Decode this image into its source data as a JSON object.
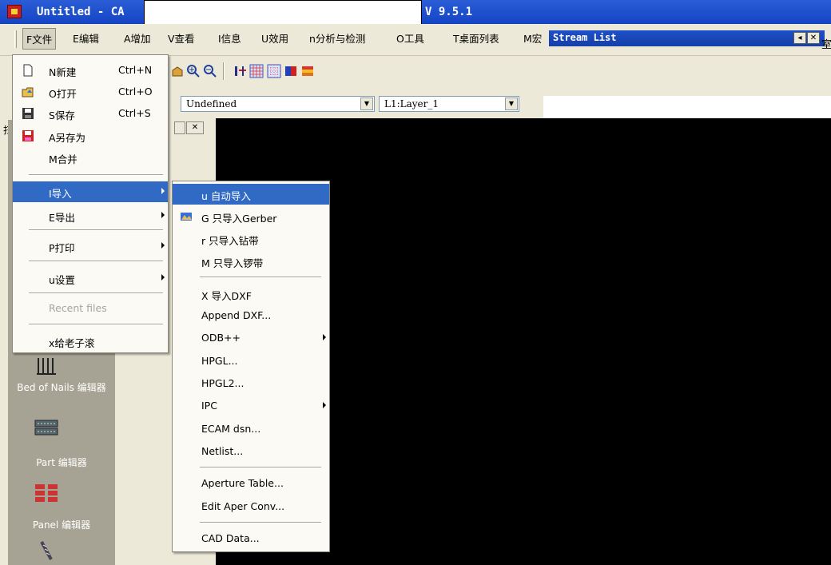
{
  "window": {
    "title": "Untitled - CA",
    "version": "V 9.5.1"
  },
  "menubar": {
    "items": [
      "F文件",
      "E编辑",
      "A增加",
      "V查看",
      "I信息",
      "U效用",
      "n分析与检测",
      "O工具",
      "T桌面列表",
      "M宏"
    ]
  },
  "stream_list": {
    "title": "Stream List",
    "right_text": "室"
  },
  "toolbar": {
    "combo1_value": "Undefined",
    "combo2_value": "L1:Layer_1"
  },
  "side_panel": {
    "tool_label_1": "Bed of Nails 编辑器",
    "tool_label_2": "Part 编辑器",
    "tool_label_3": "Panel 编辑器",
    "partial_glyph": "扫"
  },
  "file_menu": {
    "items": [
      {
        "label": "N新建",
        "shortcut": "Ctrl+N",
        "icon": "new-file-icon"
      },
      {
        "label": "O打开",
        "shortcut": "Ctrl+O",
        "icon": "open-folder-icon"
      },
      {
        "label": "S保存",
        "shortcut": "Ctrl+S",
        "icon": "save-disk-icon"
      },
      {
        "label": "A另存为",
        "shortcut": "",
        "icon": "save-as-icon"
      },
      {
        "label": "M合并",
        "shortcut": "",
        "icon": ""
      },
      {
        "label": "I导入",
        "shortcut": "",
        "icon": "",
        "submenu": true,
        "active": true
      },
      {
        "label": "E导出",
        "shortcut": "",
        "icon": "",
        "submenu": true
      },
      {
        "label": "P打印",
        "shortcut": "",
        "icon": "",
        "submenu": true
      },
      {
        "label": "u设置",
        "shortcut": "",
        "icon": "",
        "submenu": true
      },
      {
        "label": "Recent files",
        "shortcut": "",
        "icon": "",
        "disabled": true
      },
      {
        "label": "x给老子滚",
        "shortcut": "",
        "icon": ""
      }
    ]
  },
  "import_submenu": {
    "items": [
      {
        "label": "u 自动导入",
        "active": true
      },
      {
        "label": "G 只导入Gerber",
        "icon": "gerber-icon"
      },
      {
        "label": "r 只导入钻带"
      },
      {
        "label": "M 只导入锣带"
      },
      {
        "label": "X 导入DXF"
      },
      {
        "label": "Append DXF..."
      },
      {
        "label": "ODB++",
        "submenu": true
      },
      {
        "label": "HPGL..."
      },
      {
        "label": "HPGL2..."
      },
      {
        "label": "IPC",
        "submenu": true
      },
      {
        "label": "ECAM dsn..."
      },
      {
        "label": "Netlist..."
      },
      {
        "label": "Aperture Table..."
      },
      {
        "label": "Edit Aper Conv..."
      },
      {
        "label": "CAD Data..."
      }
    ]
  }
}
